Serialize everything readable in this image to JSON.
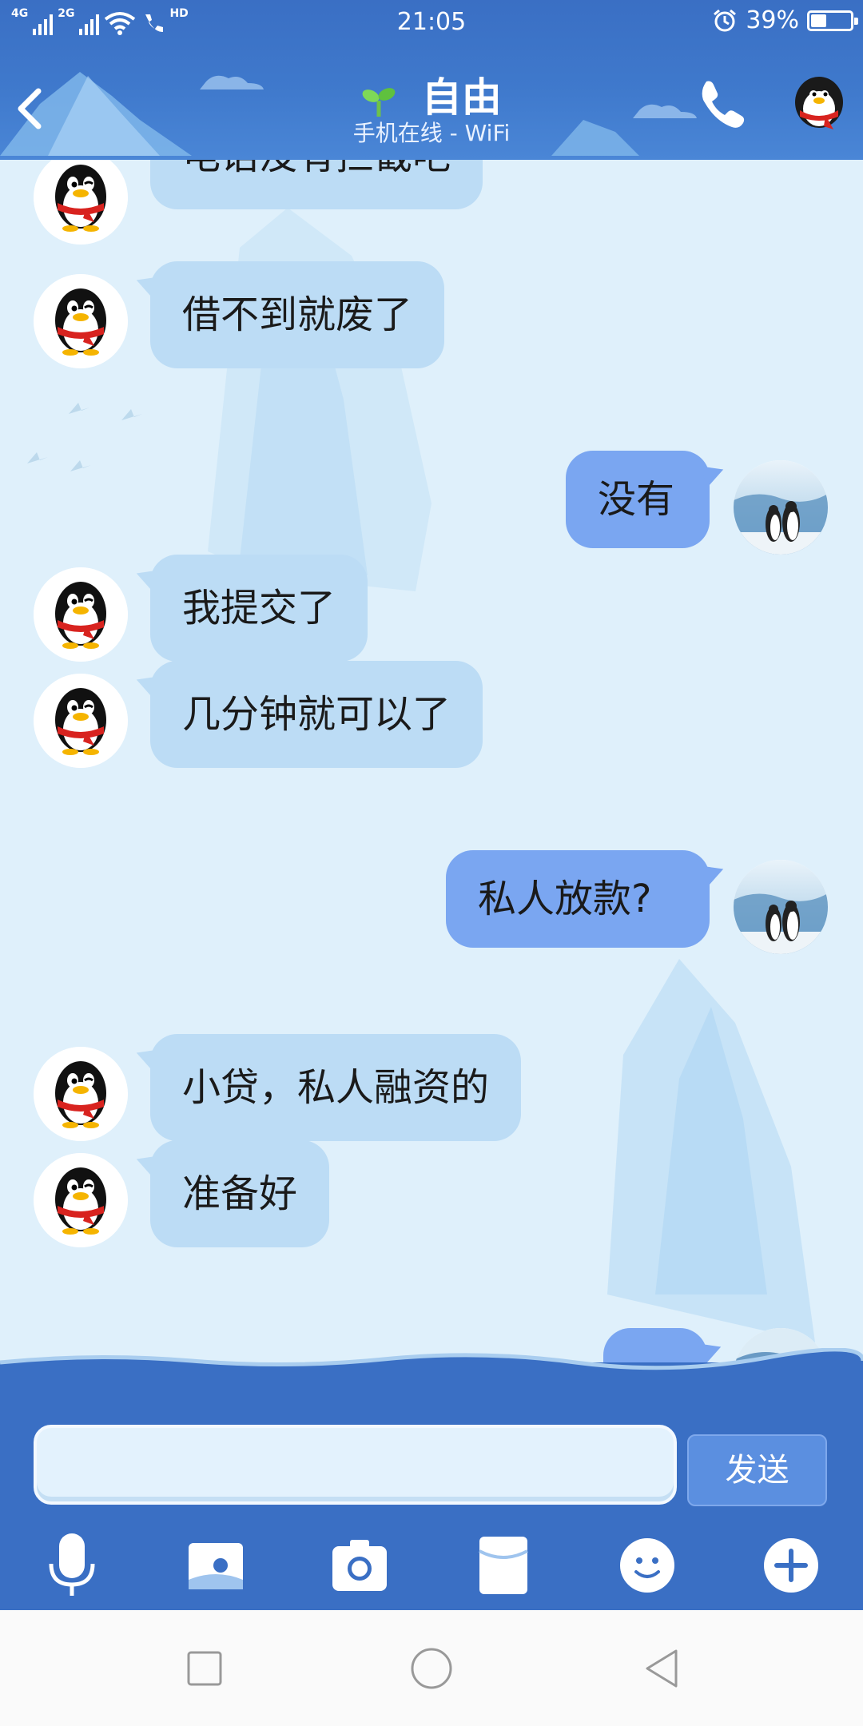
{
  "status_bar": {
    "network_1": "4G",
    "network_2": "2G",
    "hd": "HD",
    "time": "21:05",
    "battery_percent": "39%",
    "battery_level": 0.39,
    "icons": [
      "signal-icon",
      "wifi-icon",
      "hd-call-icon",
      "alarm-icon",
      "battery-icon"
    ]
  },
  "header": {
    "contact_name": "自由",
    "status_line": "手机在线 - WiFi",
    "icons": [
      "back-icon",
      "sprout-icon",
      "phone-icon",
      "penguin-profile-icon"
    ]
  },
  "messages": [
    {
      "side": "in",
      "text": "电话没有拦截吧"
    },
    {
      "side": "in",
      "text": "借不到就废了"
    },
    {
      "side": "out",
      "text": "没有"
    },
    {
      "side": "in",
      "text": "我提交了"
    },
    {
      "side": "in",
      "text": "几分钟就可以了"
    },
    {
      "side": "out",
      "text": "私人放款?"
    },
    {
      "side": "in",
      "text": "小贷，私人融资的"
    },
    {
      "side": "in",
      "text": "准备好"
    }
  ],
  "input": {
    "value": "",
    "placeholder": "",
    "send_label": "发送"
  },
  "toolbar": {
    "icons": [
      "microphone-icon",
      "image-icon",
      "camera-icon",
      "red-packet-icon",
      "emoji-icon",
      "plus-icon"
    ]
  },
  "navbar": {
    "icons": [
      "recents-icon",
      "home-icon",
      "back-nav-icon"
    ]
  },
  "colors": {
    "header_blue": "#3a6fc4",
    "incoming_bubble": "#bcdcf5",
    "outgoing_bubble": "#7aa6f1",
    "chat_bg": "#dff0fb"
  }
}
